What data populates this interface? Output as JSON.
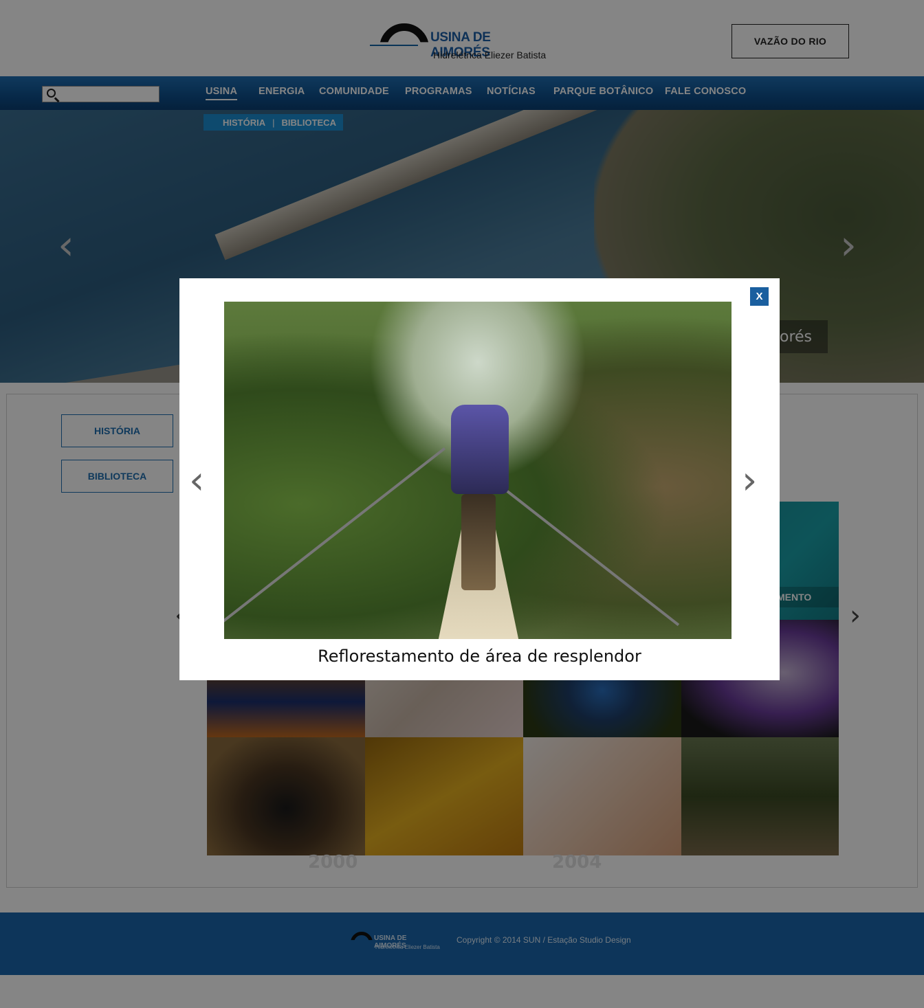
{
  "header": {
    "logo": {
      "name": "USINA DE AIMORÉS",
      "subtitle": "Hidrelétrica Eliezer Batista"
    },
    "vazao_button": "VAZÃO DO RIO"
  },
  "nav": {
    "items": [
      "USINA",
      "ENERGIA",
      "COMUNIDADE",
      "PROGRAMAS",
      "NOTÍCIAS",
      "PARQUE BOTÂNICO",
      "FALE CONOSCO"
    ],
    "active": "USINA",
    "subnav": [
      "HISTÓRIA",
      "BIBLIOTECA"
    ]
  },
  "search": {
    "icon": "search-icon"
  },
  "hero": {
    "caption": "orés"
  },
  "sidebar": {
    "items": [
      "HISTÓRIA",
      "BIBLIOTECA"
    ]
  },
  "gallery": {
    "teal_card_label": "MENTO",
    "years": [
      "2000",
      "2004"
    ]
  },
  "modal": {
    "close_label": "X",
    "caption": "Reflorestamento de área de resplendor"
  },
  "footer": {
    "logo": {
      "name": "USINA DE AIMORÉS",
      "subtitle": "Hidrelétrica Eliezer Batista"
    },
    "copyright": "Copyright © 2014 SUN / Estação Studio Design"
  },
  "colors": {
    "brand_blue": "#1a67ad",
    "nav_blue": "#0e4f8c",
    "accent_cyan": "#1c8fd3"
  }
}
